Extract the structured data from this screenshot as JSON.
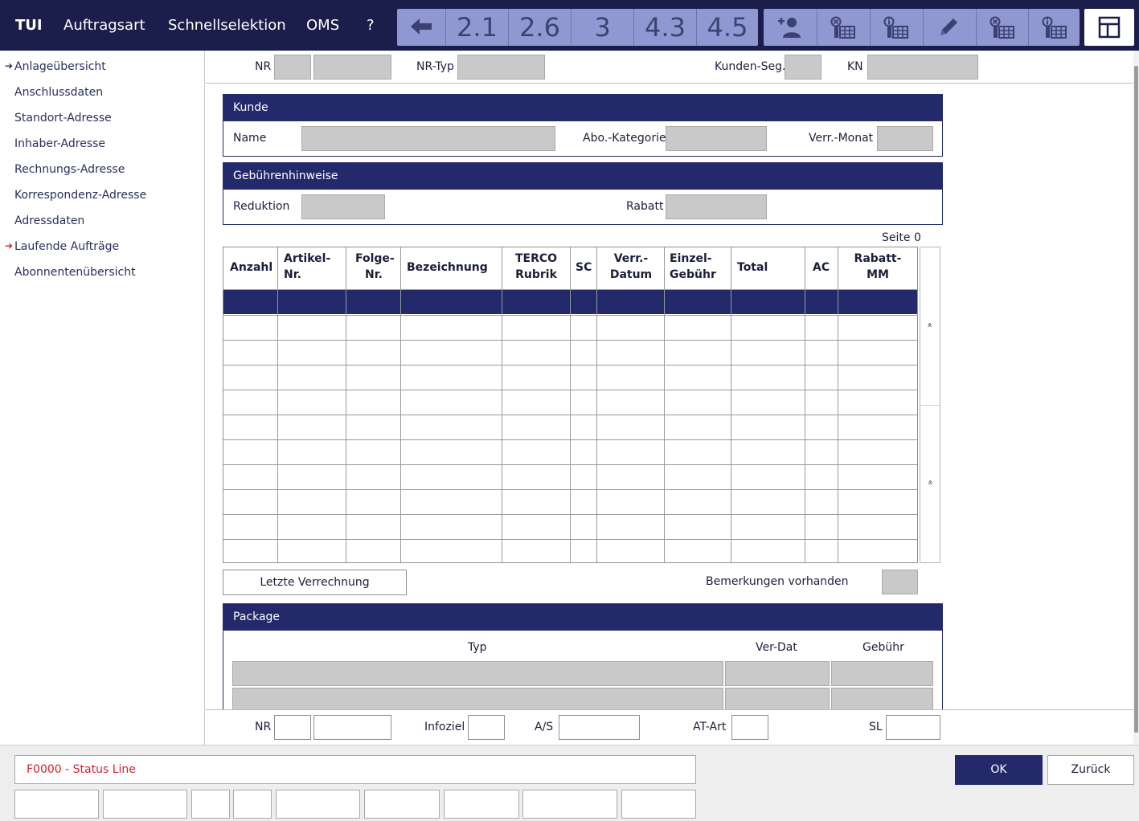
{
  "menu": {
    "brand": "TUI",
    "items": [
      "Auftragsart",
      "Schnellselektion",
      "OMS",
      "?"
    ]
  },
  "toolbar": {
    "back_icon": "back-arrow-icon",
    "numbers": [
      "2.1",
      "2.6",
      "3",
      "4.3",
      "4.5"
    ],
    "icons": [
      "add-user-icon",
      "delete-record-icon",
      "info-record-icon",
      "edit-pencil-icon",
      "remove-record-icon",
      "search-record-icon"
    ],
    "layout_icon": "layout-icon"
  },
  "sidebar": {
    "items": [
      {
        "label": "Anlageübersicht",
        "marker": "blue"
      },
      {
        "label": "Anschlussdaten",
        "marker": ""
      },
      {
        "label": "Standort-Adresse",
        "marker": ""
      },
      {
        "label": "Inhaber-Adresse",
        "marker": ""
      },
      {
        "label": "Rechnungs-Adresse",
        "marker": ""
      },
      {
        "label": "Korrespondenz-Adresse",
        "marker": ""
      },
      {
        "label": "Adressdaten",
        "marker": ""
      },
      {
        "label": "Laufende Aufträge",
        "marker": "red"
      },
      {
        "label": "Abonnentenübersicht",
        "marker": ""
      }
    ]
  },
  "header_fields": {
    "nr": "NR",
    "nr_typ": "NR-Typ",
    "kunden_seg": "Kunden-Seg.",
    "kn": "KN"
  },
  "kunde": {
    "title": "Kunde",
    "name": "Name",
    "abo_kategorie": "Abo.-Kategorie",
    "verr_monat": "Verr.-Monat"
  },
  "gebuehren": {
    "title": "Gebührenhinweise",
    "reduktion": "Reduktion",
    "rabatt": "Rabatt"
  },
  "table": {
    "page_label": "Seite 0",
    "headers": [
      [
        "Anzahl"
      ],
      [
        "Artikel-",
        "Nr."
      ],
      [
        "Folge-",
        "Nr."
      ],
      [
        "Bezeichnung"
      ],
      [
        "TERCO",
        "Rubrik"
      ],
      [
        "SC"
      ],
      [
        "Verr.-",
        "Datum"
      ],
      [
        "Einzel-",
        "Gebühr"
      ],
      [
        "Total"
      ],
      [
        "AC"
      ],
      [
        "Rabatt-",
        "MM"
      ]
    ],
    "scroll_up": "«",
    "scroll_down": "»"
  },
  "actions": {
    "letzte_verrechnung": "Letzte Verrechnung",
    "bemerkungen": "Bemerkungen vorhanden"
  },
  "package": {
    "title": "Package",
    "typ": "Typ",
    "ver_dat": "Ver-Dat",
    "gebuehr": "Gebühr"
  },
  "bottom_fields": {
    "nr": "NR",
    "infoziel": "Infoziel",
    "as": "A/S",
    "at_art": "AT-Art",
    "sl": "SL"
  },
  "footer": {
    "status": "F0000 - Status Line",
    "ok": "OK",
    "zurueck": "Zurück"
  }
}
